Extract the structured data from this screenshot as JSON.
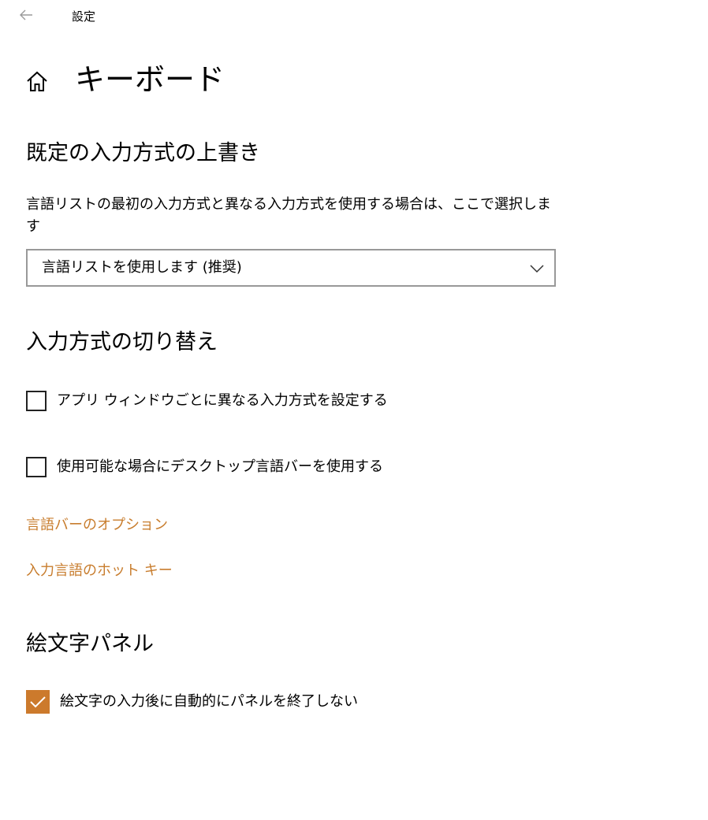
{
  "window": {
    "title": "設定",
    "back_icon": "back-arrow-icon"
  },
  "page": {
    "title": "キーボード",
    "home_icon": "home-icon"
  },
  "override": {
    "heading": "既定の入力方式の上書き",
    "description": "言語リストの最初の入力方式と異なる入力方式を使用する場合は、ここで選択します",
    "dropdown_value": "言語リストを使用します (推奨)"
  },
  "switching": {
    "heading": "入力方式の切り替え",
    "per_app_label": "アプリ ウィンドウごとに異なる入力方式を設定する",
    "per_app_checked": false,
    "desktop_bar_label": "使用可能な場合にデスクトップ言語バーを使用する",
    "desktop_bar_checked": false,
    "link_langbar_options": "言語バーのオプション",
    "link_hotkeys": "入力言語のホット キー"
  },
  "emoji": {
    "heading": "絵文字パネル",
    "keep_open_label": "絵文字の入力後に自動的にパネルを終了しない",
    "keep_open_checked": true
  },
  "colors": {
    "accent": "#cc7a2c",
    "link": "#c87d2e"
  }
}
